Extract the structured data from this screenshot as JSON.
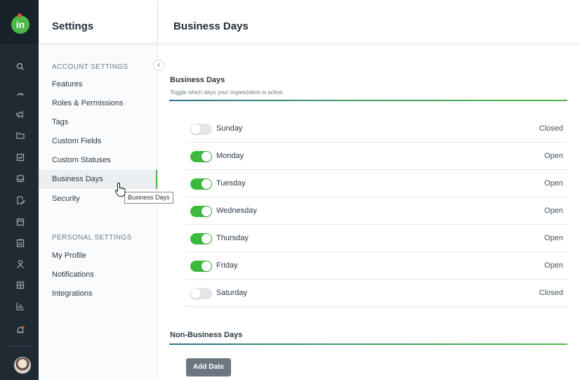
{
  "rail": {
    "logo_text": "in",
    "icons": [
      "search-icon",
      "dashboard-icon",
      "megaphone-icon",
      "folder-icon",
      "checkbox-icon",
      "inbox-icon",
      "document-edit-icon",
      "calendar-icon",
      "clipboard-icon",
      "person-icon",
      "grid-icon",
      "bar-chart-icon",
      "notification-icon"
    ]
  },
  "sidebar": {
    "title": "Settings",
    "account_label": "ACCOUNT SETTINGS",
    "account_items": [
      "Features",
      "Roles & Permissions",
      "Tags",
      "Custom Fields",
      "Custom Statuses",
      "Business Days",
      "Security"
    ],
    "personal_label": "PERSONAL SETTINGS",
    "personal_items": [
      "My Profile",
      "Notifications",
      "Integrations"
    ],
    "active_item": "Business Days"
  },
  "tooltip": "Business Days",
  "main": {
    "title": "Business Days",
    "section_title": "Business Days",
    "section_subtitle": "Toggle which days your organization is active.",
    "days": [
      {
        "name": "Sunday",
        "status": "Closed",
        "enabled": false
      },
      {
        "name": "Monday",
        "status": "Open",
        "enabled": true
      },
      {
        "name": "Tuesday",
        "status": "Open",
        "enabled": true
      },
      {
        "name": "Wednesday",
        "status": "Open",
        "enabled": true
      },
      {
        "name": "Thursday",
        "status": "Open",
        "enabled": true
      },
      {
        "name": "Friday",
        "status": "Open",
        "enabled": true
      },
      {
        "name": "Saturday",
        "status": "Closed",
        "enabled": false
      }
    ],
    "non_business_title": "Non-Business Days",
    "add_date_label": "Add Date"
  },
  "colors": {
    "rail_bg": "#1f2a33",
    "accent_green": "#4cb848",
    "toggle_on": "#3cb93c",
    "toggle_off": "#e4e7ea",
    "button_gray": "#6c7781"
  }
}
